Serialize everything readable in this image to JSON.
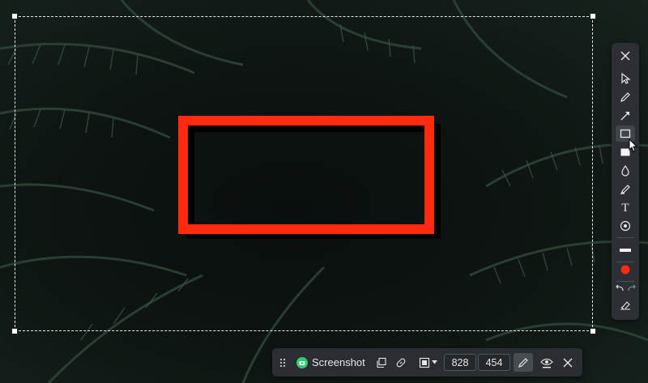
{
  "toolbar": {
    "close_icon": "close-icon",
    "tools": [
      {
        "name": "select-tool",
        "icon": "cursor-arrow-icon"
      },
      {
        "name": "pen-tool",
        "icon": "pencil-icon"
      },
      {
        "name": "arrow-tool",
        "icon": "arrow-icon"
      },
      {
        "name": "rectangle-tool",
        "icon": "rectangle-outline-icon",
        "active": true
      },
      {
        "name": "filled-rectangle-tool",
        "icon": "filled-rectangle-icon"
      },
      {
        "name": "blur-tool",
        "icon": "drop-icon"
      },
      {
        "name": "highlighter-tool",
        "icon": "highlighter-icon"
      },
      {
        "name": "text-tool",
        "icon": "text-icon",
        "glyph": "T"
      },
      {
        "name": "step-tool",
        "icon": "step-marker-icon"
      }
    ],
    "line_width": "line-thickness-icon",
    "current_color": "#ff2a10",
    "undo_icon": "undo-icon",
    "redo_icon": "redo-icon",
    "clear_icon": "eraser-icon"
  },
  "bottom_bar": {
    "drag_icon": "drag-handle-icon",
    "app_label": "Screenshot",
    "width": "828",
    "height": "454"
  },
  "colors": {
    "annotation": "#ff2a10",
    "panel": "#2c3034",
    "app_icon": "#2ecc71"
  }
}
